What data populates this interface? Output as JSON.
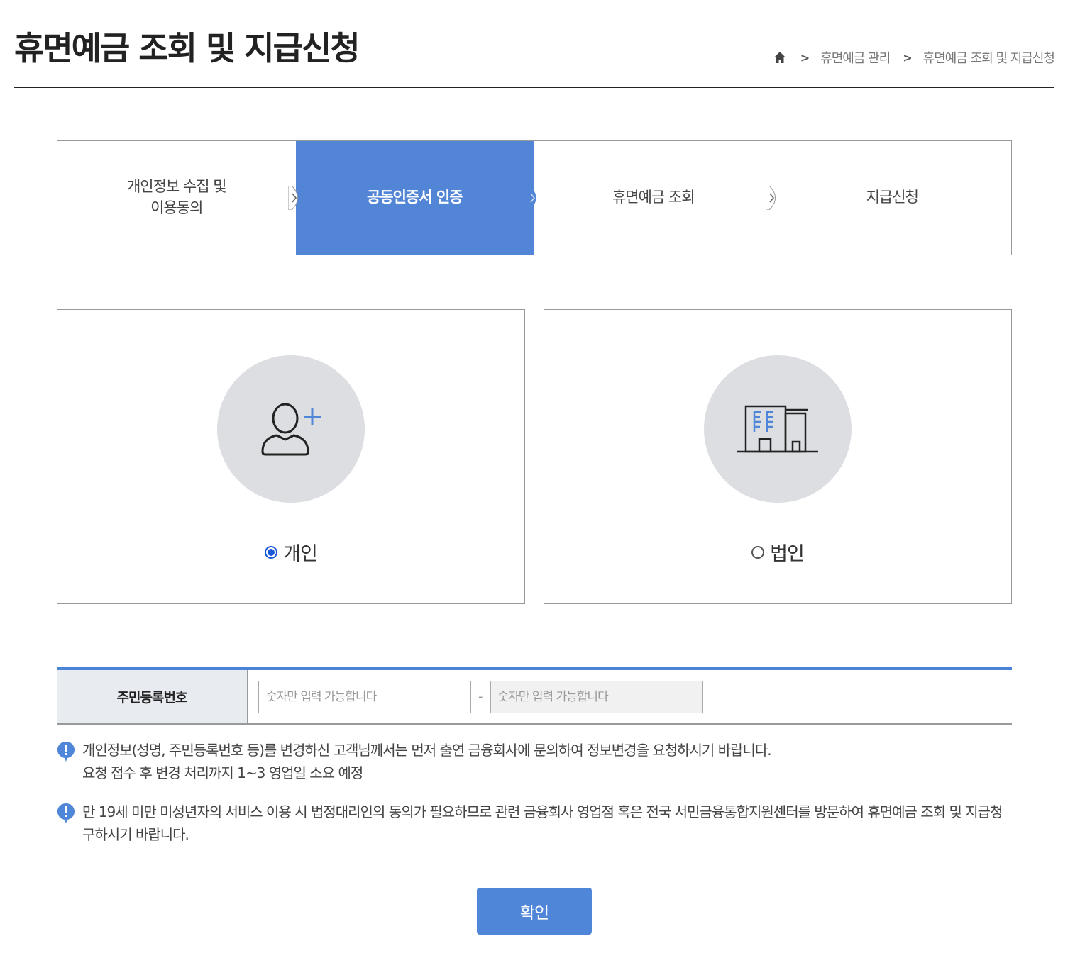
{
  "header": {
    "title": "휴면예금 조회 및 지급신청",
    "breadcrumb": {
      "home_icon": "home-icon",
      "items": [
        "휴면예금 관리",
        "휴면예금 조회 및 지급신청"
      ],
      "separator": ">"
    }
  },
  "steps": [
    {
      "line1": "개인정보 수집 및",
      "line2": "이용동의",
      "active": false
    },
    {
      "line1": "공동인증서 인증",
      "line2": "",
      "active": true
    },
    {
      "line1": "휴면예금 조회",
      "line2": "",
      "active": false
    },
    {
      "line1": "지급신청",
      "line2": "",
      "active": false
    }
  ],
  "customer_type": {
    "individual": {
      "label": "개인",
      "checked": true,
      "icon": "person-add-icon"
    },
    "corporate": {
      "label": "법인",
      "checked": false,
      "icon": "building-icon"
    }
  },
  "form": {
    "rrn_label": "주민등록번호",
    "rrn_front_placeholder": "숫자만 입력 가능합니다",
    "rrn_back_placeholder": "숫자만 입력 가능합니다",
    "dash": "-"
  },
  "notices": [
    {
      "line1": "개인정보(성명, 주민등록번호 등)를 변경하신 고객님께서는 먼저 출연 금융회사에 문의하여 정보변경을 요청하시기 바랍니다.",
      "line2": "요청 접수 후 변경 처리까지 1~3 영업일 소요 예정"
    },
    {
      "line1": "만 19세 미만 미성년자의 서비스 이용 시 법정대리인의 동의가 필요하므로 관련 금융회사 영업점 혹은 전국 서민금융통합지원센터를 방문하여 휴면예금 조회 및 지급청구하시기 바랍니다.",
      "line2": ""
    }
  ],
  "confirm_button": "확인",
  "colors": {
    "accent": "#5285d6",
    "form_top_border": "#4a84d6",
    "button": "#4f86d8",
    "icon_circle": "#dcdee2",
    "notice_icon": "#4f86d8"
  }
}
